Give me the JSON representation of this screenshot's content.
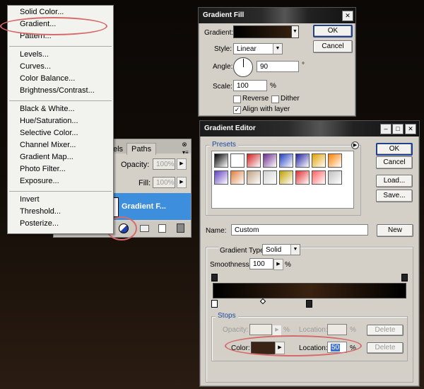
{
  "context_menu": {
    "groups": [
      [
        "Solid Color...",
        "Gradient...",
        "Pattern..."
      ],
      [
        "Levels...",
        "Curves...",
        "Color Balance...",
        "Brightness/Contrast..."
      ],
      [
        "Black & White...",
        "Hue/Saturation...",
        "Selective Color...",
        "Channel Mixer...",
        "Gradient Map...",
        "Photo Filter...",
        "Exposure..."
      ],
      [
        "Invert",
        "Threshold...",
        "Posterize..."
      ]
    ]
  },
  "layers_panel": {
    "tabs": [
      "els",
      "Paths"
    ],
    "opacity_label": "Opacity:",
    "opacity_value": "100%",
    "fill_label": "Fill:",
    "fill_value": "100%",
    "layer_name": "Gradient F..."
  },
  "gradient_fill": {
    "title": "Gradient Fill",
    "gradient_label": "Gradient:",
    "style_label": "Style:",
    "style_value": "Linear",
    "angle_label": "Angle:",
    "angle_value": "90",
    "angle_unit": "°",
    "scale_label": "Scale:",
    "scale_value": "100",
    "scale_unit": "%",
    "reverse_label": "Reverse",
    "dither_label": "Dither",
    "align_label": "Align with layer",
    "reverse_checked": false,
    "dither_checked": false,
    "align_checked": true,
    "ok": "OK",
    "cancel": "Cancel",
    "gradient_colors": [
      "#000000",
      "#3a2210"
    ]
  },
  "gradient_editor": {
    "title": "Gradient Editor",
    "presets_label": "Presets",
    "ok": "OK",
    "reset": "Cancel",
    "load": "Load...",
    "save": "Save...",
    "name_label": "Name:",
    "name_value": "Custom",
    "new_label": "New",
    "gradient_type_label": "Gradient Type:",
    "gradient_type_value": "Solid",
    "smoothness_label": "Smoothness:",
    "smoothness_value": "100",
    "smoothness_unit": "%",
    "stops_label": "Stops",
    "opacity_label": "Opacity:",
    "opacity_unit": "%",
    "location_label": "Location:",
    "location_unit": "%",
    "delete_label": "Delete",
    "color_label": "Color:",
    "location_value": "50",
    "stop_color": "#3a2416",
    "presets": [
      [
        "#000000",
        "#ffffff",
        "#d02020",
        "#6a2a8a",
        "#2040c0",
        "#2020a0",
        "#e0a000",
        "#ff8000"
      ],
      [
        "#6040c0",
        "#e08040",
        "#c0a080",
        "#d0d0d0",
        "#c0a000",
        "#e03030",
        "#ff6060",
        "#c0c0c0"
      ]
    ]
  }
}
